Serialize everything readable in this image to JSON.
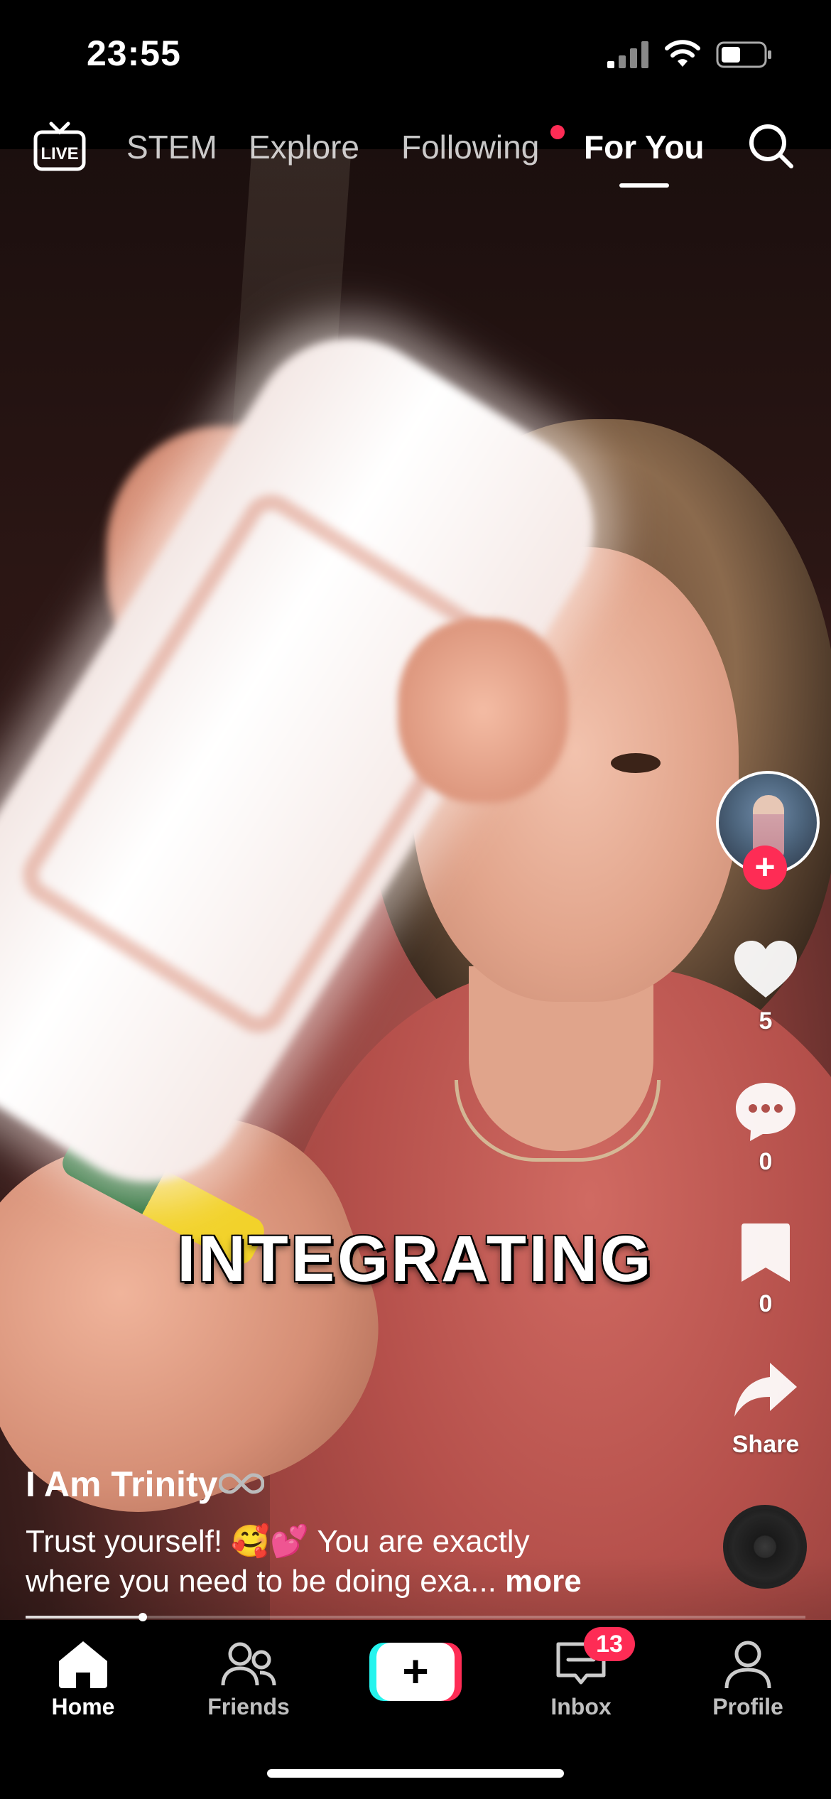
{
  "status_bar": {
    "time": "23:55"
  },
  "top_nav": {
    "live_label": "LIVE",
    "tabs": [
      {
        "label": "STEM",
        "active": false
      },
      {
        "label": "Explore",
        "active": false
      },
      {
        "label": "Following",
        "active": false,
        "has_notification_dot": true
      },
      {
        "label": "For You",
        "active": true
      }
    ],
    "search_icon": "search-icon"
  },
  "video": {
    "overlay_text": "INTEGRATING"
  },
  "actions": {
    "follow_label": "+",
    "likes": "5",
    "comments": "0",
    "saves": "0",
    "share_label": "Share"
  },
  "post": {
    "author": "I Am Trinity",
    "description_line1": "Trust yourself! 🥰💕 You are exactly",
    "description_line2": "where you need to be doing exa...",
    "more_label": "more",
    "progress_fraction": 0.15
  },
  "tabbar": {
    "home": "Home",
    "friends": "Friends",
    "create": "+",
    "inbox": "Inbox",
    "inbox_badge": "13",
    "profile": "Profile"
  },
  "colors": {
    "accent": "#fe2c55",
    "cyan": "#25f4ee",
    "background": "#000000"
  }
}
